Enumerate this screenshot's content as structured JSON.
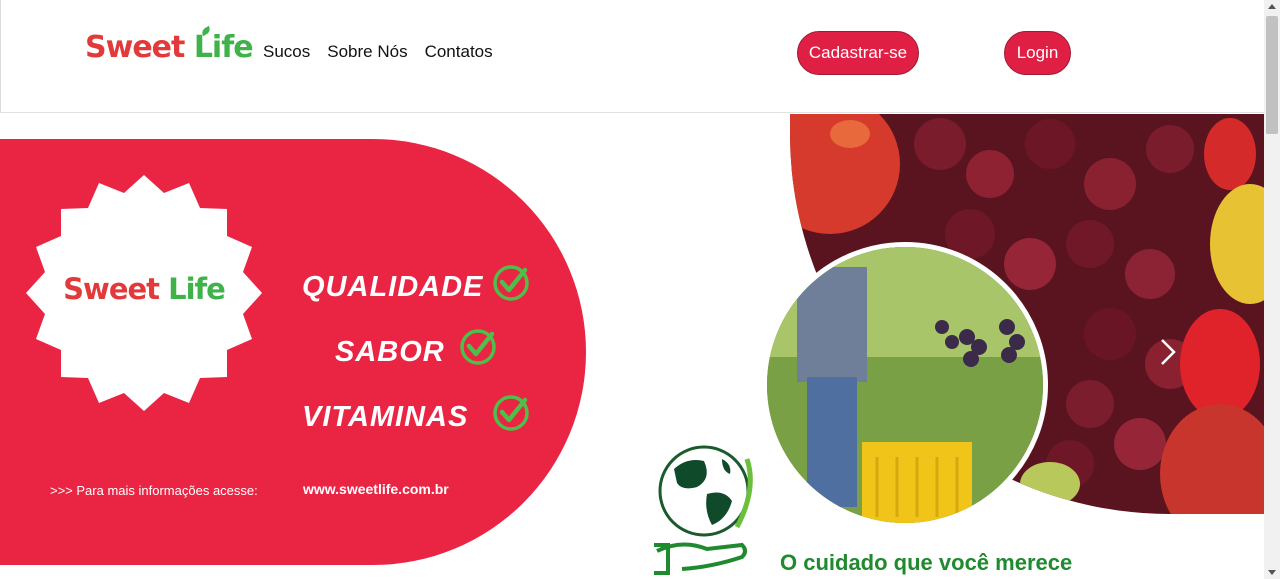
{
  "header": {
    "logo": {
      "word1": "Sweet",
      "word2": "Life"
    },
    "nav": [
      {
        "label": "Sucos"
      },
      {
        "label": "Sobre Nós"
      },
      {
        "label": "Contatos"
      }
    ],
    "register_label": "Cadastrar-se",
    "login_label": "Login"
  },
  "banner": {
    "badge_logo": {
      "word1": "Sweet",
      "word2": "Life"
    },
    "features": [
      "QUALIDADE",
      "SABOR",
      "VITAMINAS"
    ],
    "info_text": ">>> Para mais informações acesse:",
    "url": "www.sweetlife.com.br",
    "tagline": "O cuidado que você merece",
    "next_icon": "chevron-right-icon"
  },
  "colors": {
    "brand_red": "#ea2544",
    "button_red": "#e01f45",
    "logo_red": "#e23a3a",
    "logo_green": "#3fb34a",
    "check_green": "#4cc04a",
    "tagline_green": "#1f8a2e"
  }
}
